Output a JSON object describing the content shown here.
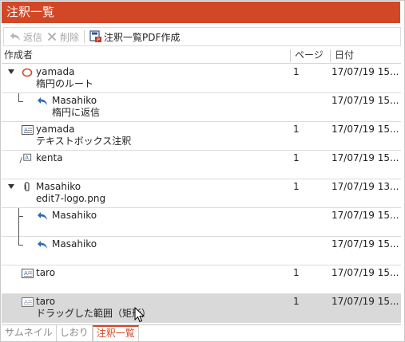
{
  "title": "注釈一覧",
  "toolbar": {
    "reply_label": "返信",
    "delete_label": "削除",
    "pdf_label": "注釈一覧PDF作成"
  },
  "columns": {
    "author": "作成者",
    "page": "ページ",
    "date": "日付"
  },
  "rows": [
    {
      "author": "yamada",
      "content": "楕円のルート",
      "page": "1",
      "date": "17/07/19 15..."
    },
    {
      "author": "Masahiko",
      "content": "楕円に返信",
      "page": "",
      "date": "17/07/19 15..."
    },
    {
      "author": "yamada",
      "content": "テキストボックス注釈",
      "page": "1",
      "date": "17/07/19 15..."
    },
    {
      "author": "kenta",
      "content": "",
      "page": "1",
      "date": "17/07/19 15..."
    },
    {
      "author": "Masahiko",
      "content": "edit7-logo.png",
      "page": "1",
      "date": "17/07/19 13..."
    },
    {
      "author": "Masahiko",
      "content": "",
      "page": "",
      "date": "17/07/19 15..."
    },
    {
      "author": "Masahiko",
      "content": "",
      "page": "",
      "date": "17/07/19 15..."
    },
    {
      "author": "taro",
      "content": "",
      "page": "1",
      "date": "17/07/19 15..."
    },
    {
      "author": "taro",
      "content": "ドラッグした範囲（矩形）",
      "page": "1",
      "date": "17/07/19 15..."
    }
  ],
  "tabs": {
    "thumbnail": "サムネイル",
    "bookmark": "しおり",
    "annotations": "注釈一覧"
  },
  "colors": {
    "accent": "#d24726",
    "reply_arrow": "#2f6db5",
    "selected_row": "#d9d9d9"
  },
  "icons": {
    "row0": "ellipse-icon",
    "row1": "reply-icon",
    "row2": "textbox-icon",
    "row3": "freehand-icon",
    "row4": "paperclip-icon",
    "row5": "reply-icon",
    "row6": "reply-icon",
    "row7": "textbox-icon",
    "row8": "textbox-icon"
  }
}
